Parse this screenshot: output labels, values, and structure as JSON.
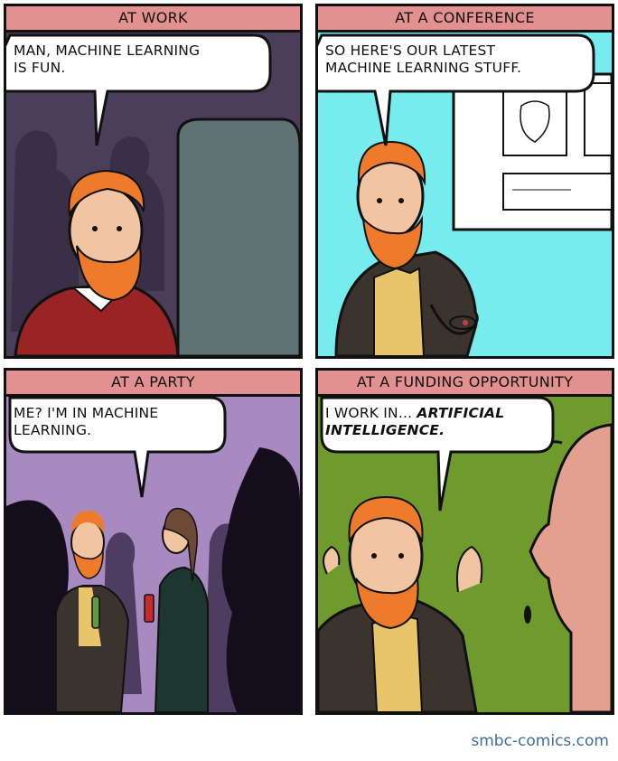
{
  "panels": [
    {
      "caption": "AT WORK",
      "speech": "MAN, MACHINE LEARNING\nIS FUN."
    },
    {
      "caption": "AT A CONFERENCE",
      "speech": "SO HERE'S OUR LATEST\nMACHINE LEARNING STUFF."
    },
    {
      "caption": "AT A PARTY",
      "speech": "ME? I'M IN MACHINE\nLEARNING."
    },
    {
      "caption": "AT A FUNDING OPPORTUNITY",
      "speech_plain": "I WORK IN... ",
      "speech_emph": "ARTIFICIAL\nINTELLIGENCE."
    }
  ],
  "credit": "smbc-comics.com",
  "colors": {
    "caption_bg": "#e39091",
    "work_bg": "#4b3e58",
    "conference_bg": "#76ecee",
    "party_bg": "#a78bc0",
    "funding_bg": "#6f9a2e",
    "beard": "#ee7a2c",
    "credit": "#3f6f96"
  }
}
